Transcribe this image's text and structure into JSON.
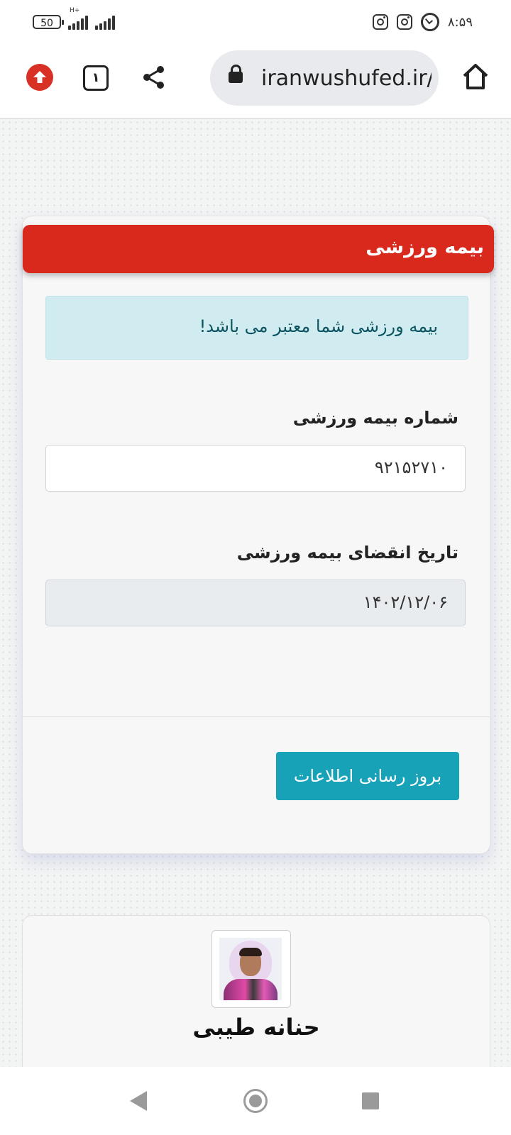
{
  "status_bar": {
    "battery": "50",
    "network": "H+",
    "clock": "۸:۵۹",
    "icons": [
      "instagram-icon",
      "instagram-icon",
      "alarm-icon"
    ]
  },
  "browser": {
    "url": "iranwushufed.ir/s",
    "tab_count": "۱",
    "icons": [
      "upload-icon",
      "tabs-icon",
      "share-icon",
      "lock-icon",
      "home-icon"
    ]
  },
  "insurance_card": {
    "title": "بیمه ورزشی",
    "alert": "بیمه ورزشی شما معتبر می باشد!",
    "number_label": "شماره بیمه ورزشی",
    "number_value": "۹۲۱۵۲۷۱۰",
    "expiry_label": "تاریخ انقضای بیمه ورزشی",
    "expiry_value": "۱۴۰۲/۱۲/۰۶",
    "update_button": "بروز رسانی اطلاعات"
  },
  "profile_card": {
    "name": "حنانه طیبی"
  },
  "colors": {
    "header_red": "#d9291c",
    "button_teal": "#17a2b8",
    "alert_bg": "#d1ecf1",
    "alert_text": "#0c5460"
  }
}
